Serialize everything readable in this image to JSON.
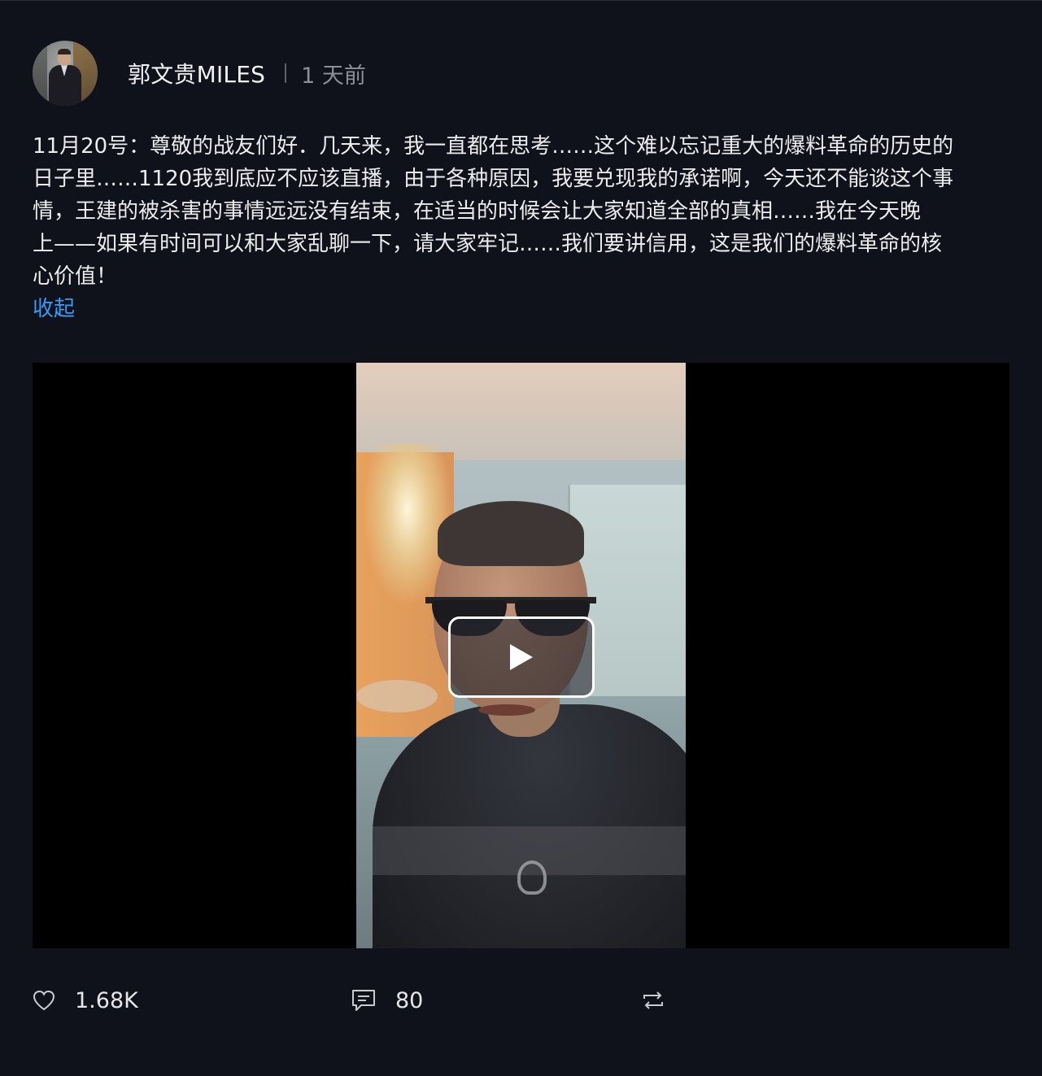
{
  "post": {
    "author": "郭文贵MILES",
    "time": "1 天前",
    "content": "11月20号：尊敬的战友们好．几天来，我一直都在思考……这个难以忘记重大的爆料革命的历史的\n日子里……1120我到底应不应该直播，由于各种原因，我要兑现我的承诺啊，今天还不能谈这个事\n情，王建的被杀害的事情远远没有结束，在适当的时候会让大家知道全部的真相……我在今天晚\n上——如果有时间可以和大家乱聊一下，请大家牢记……我们要讲信用，这是我们的爆料革命的核\n心价值！",
    "collapse_label": "收起"
  },
  "actions": {
    "likes": "1.68K",
    "comments": "80"
  },
  "icons": {
    "like": "heart-icon",
    "comment": "comment-icon",
    "repost": "repost-icon",
    "play": "play-icon"
  }
}
